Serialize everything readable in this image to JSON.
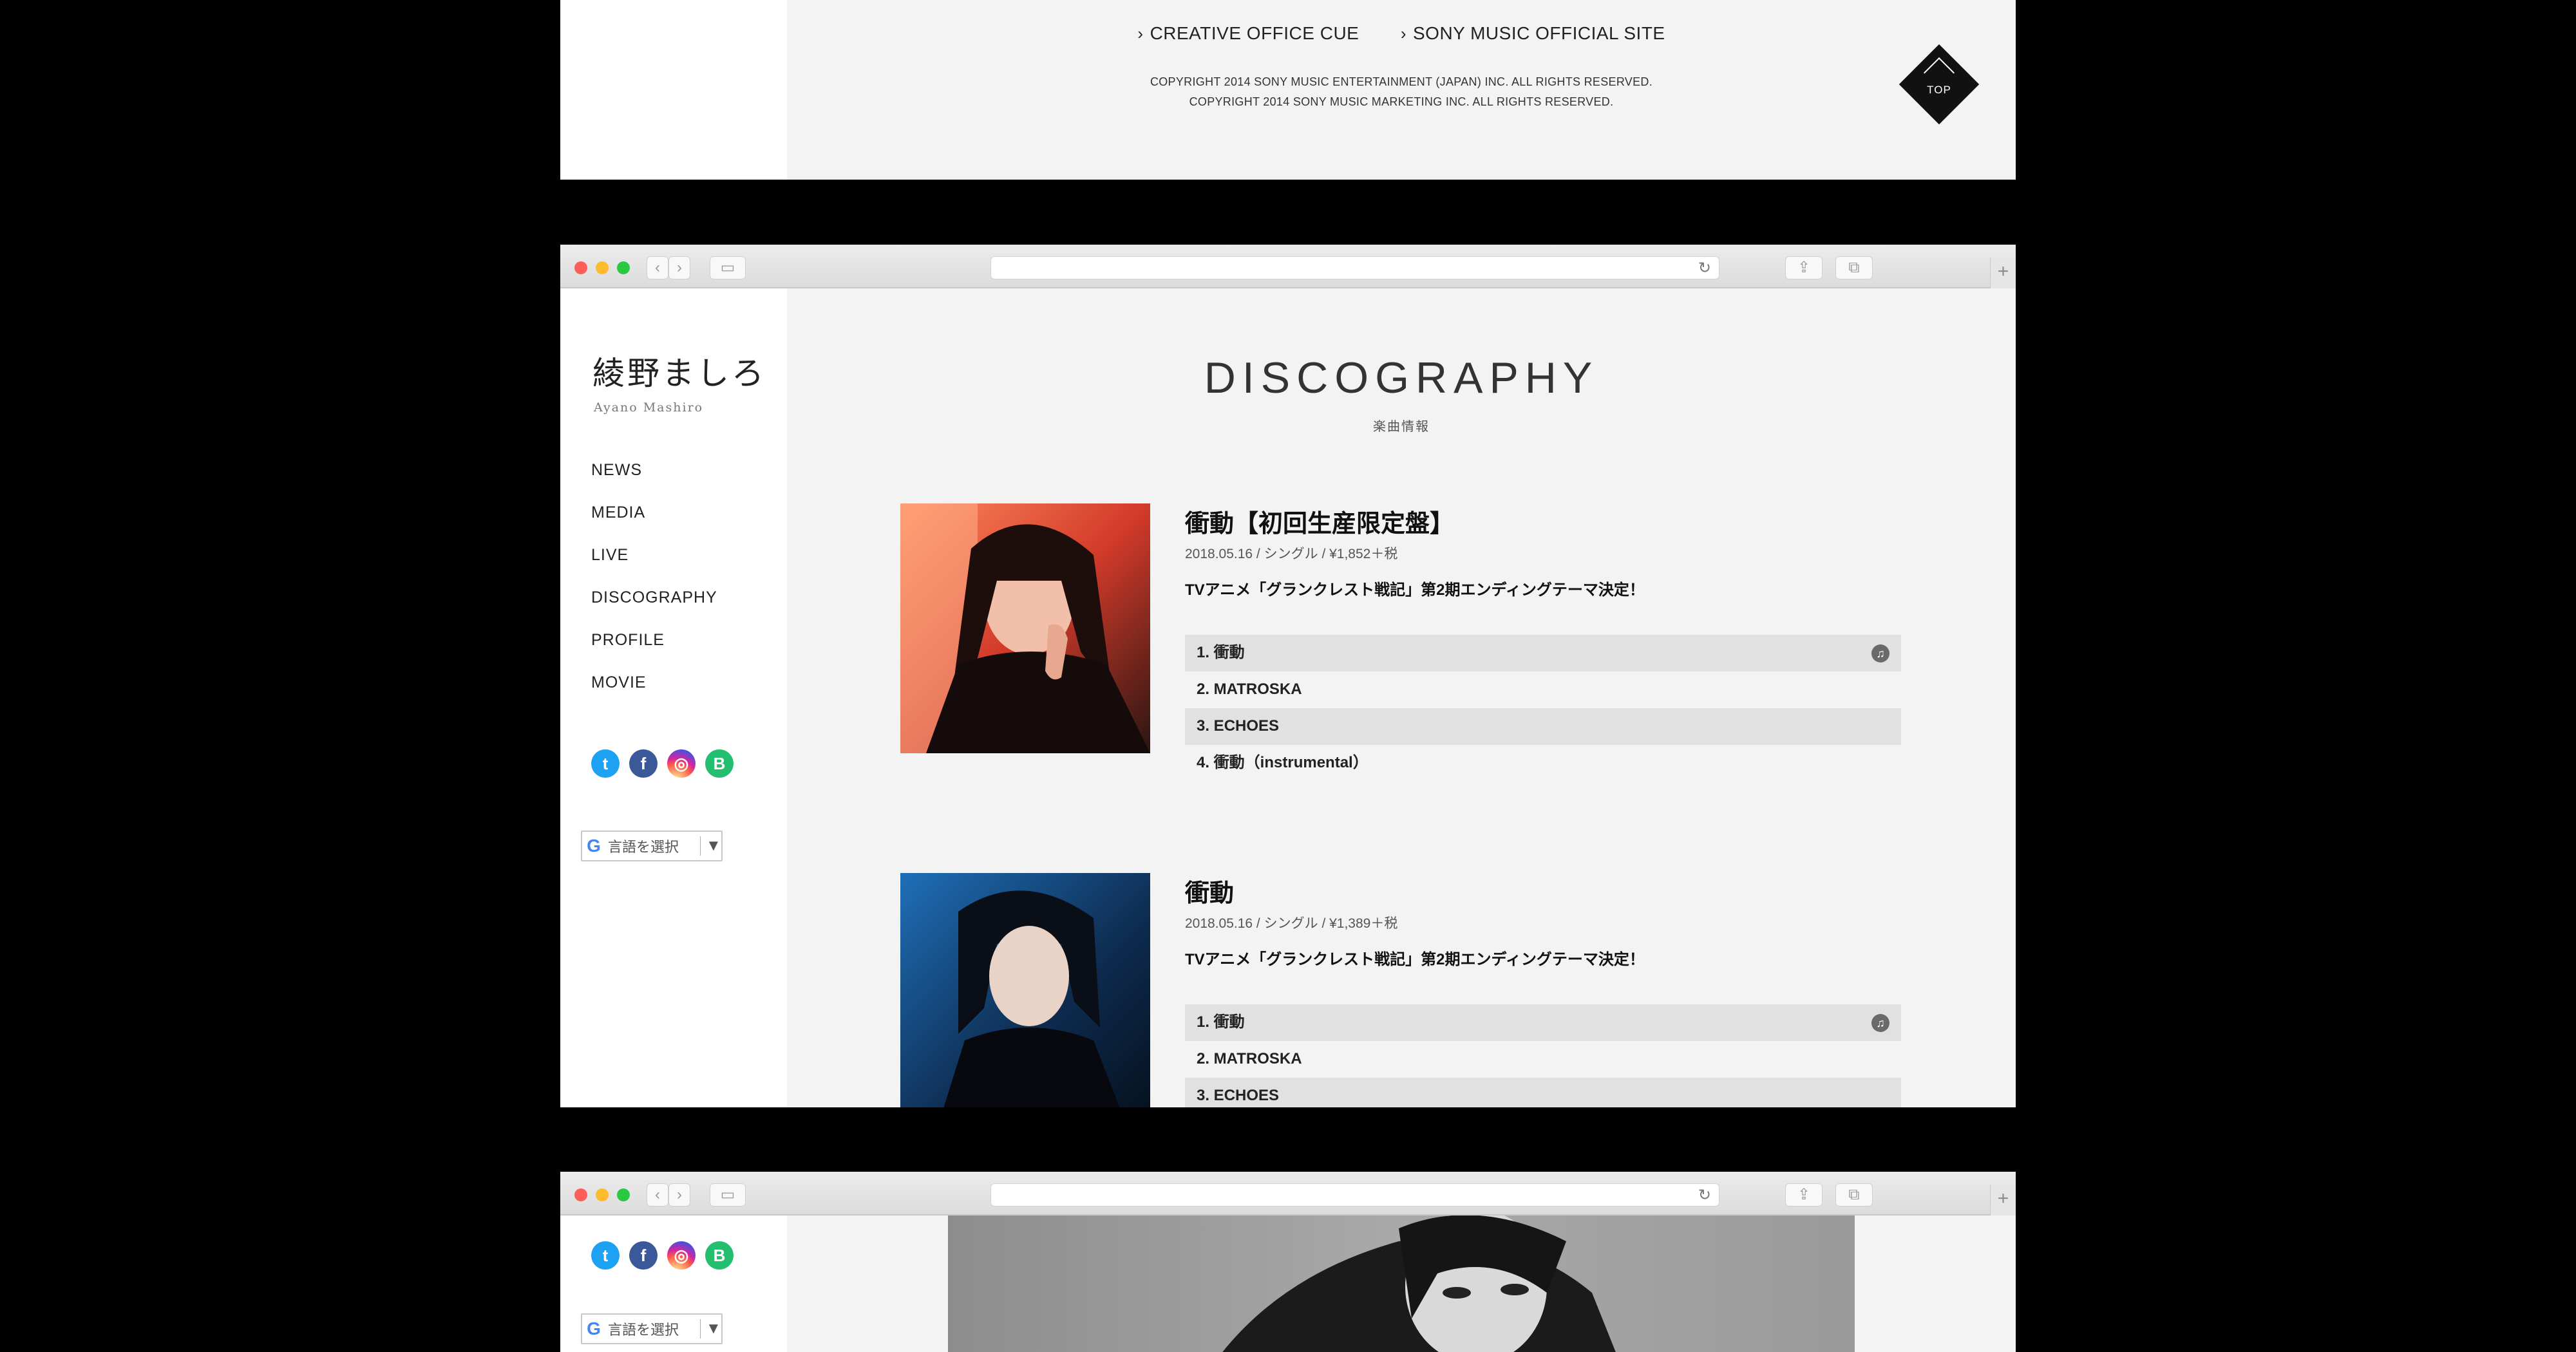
{
  "footer": {
    "links": [
      "CREATIVE OFFICE CUE",
      "SONY MUSIC OFFICIAL SITE"
    ],
    "copyright": [
      "COPYRIGHT 2014 SONY MUSIC ENTERTAINMENT (JAPAN) INC. ALL RIGHTS RESERVED.",
      "COPYRIGHT 2014 SONY MUSIC MARKETING INC. ALL RIGHTS RESERVED."
    ],
    "top_label": "TOP"
  },
  "browser": {
    "back_icon": "chevron-left-icon",
    "forward_icon": "chevron-right-icon",
    "reload_icon": "reload-icon",
    "new_tab_symbol": "+"
  },
  "site": {
    "logo_jp": "綾野ましろ",
    "logo_en": "Ayano Mashiro",
    "nav": [
      "NEWS",
      "MEDIA",
      "LIVE",
      "DISCOGRAPHY",
      "PROFILE",
      "MOVIE"
    ],
    "social": [
      {
        "name": "twitter",
        "glyph": "t",
        "color": "#1da1f2"
      },
      {
        "name": "facebook",
        "glyph": "f",
        "color": "#3b5998"
      },
      {
        "name": "instagram",
        "glyph": "◎",
        "color": "#d6249f"
      },
      {
        "name": "blog",
        "glyph": "B",
        "color": "#24bf6e"
      }
    ],
    "language_select": {
      "label": "言語を選択",
      "arrow": "▼",
      "g": "G"
    }
  },
  "discography": {
    "title": "DISCOGRAPHY",
    "subtitle": "楽曲情報",
    "releases": [
      {
        "title": "衝動【初回生産限定盤】",
        "meta": "2018.05.16 / シングル / ¥1,852＋税",
        "desc": "TVアニメ「グランクレスト戦記」第2期エンディングテーマ決定！",
        "tracks": [
          "1. 衝動",
          "2. MATROSKA",
          "3. ECHOES",
          "4. 衝動（instrumental）"
        ]
      },
      {
        "title": "衝動",
        "meta": "2018.05.16 / シングル / ¥1,389＋税",
        "desc": "TVアニメ「グランクレスト戦記」第2期エンディングテーマ決定！",
        "tracks": [
          "1. 衝動",
          "2. MATROSKA",
          "3. ECHOES"
        ]
      }
    ]
  }
}
